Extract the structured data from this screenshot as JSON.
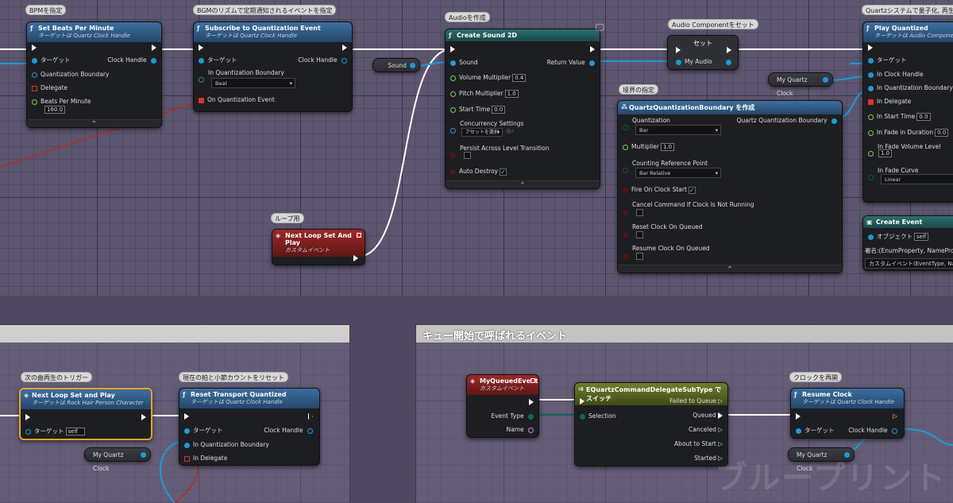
{
  "colors": {
    "exec": "#ffffff",
    "object": "#1c9ad6",
    "float": "#6bd14e",
    "delegate": "#e23030",
    "struct": "#2b8a8a",
    "byte": "#0a5a4a",
    "bool": "#8a1a1a",
    "name": "#c87df0"
  },
  "comments": {
    "bpm": "BPMを指定",
    "subscribe": "BGMのリズムで定期通知されるイベントを指定",
    "audio": "Audioを作成",
    "audio_comp": "Audio Componentをセット",
    "quantized": "Quartzシステムで量子化, 再生開",
    "boundary": "境界の指定",
    "loop": "ループ用",
    "next_trigger": "次の曲再生のトリガー",
    "reset": "現在の拍と小節カウントをリセット",
    "resume": "クロックを再開"
  },
  "regions": {
    "queue_title": "キュー開始で呼ばれるイベント"
  },
  "nodes": {
    "set_bpm": {
      "title": "Set Beats Per Minute",
      "sub": "ターゲットは Quartz Clock Handle",
      "target": "ターゲット",
      "clock_handle": "Clock Handle",
      "quant_boundary": "Quantization Boundary",
      "delegate": "Delegate",
      "bpm_label": "Beats Per Minute",
      "bpm_value": "160.0"
    },
    "subscribe": {
      "title": "Subscribe to Quantization Event",
      "sub": "ターゲットは Quartz Clock Handle",
      "target": "ターゲット",
      "clock_handle": "Clock Handle",
      "in_boundary": "In Quantization Boundary",
      "boundary_value": "Beat",
      "on_event": "On Quantization Event"
    },
    "create_sound": {
      "title": "Create Sound 2D",
      "sound": "Sound",
      "return_value": "Return Value",
      "volume": "Volume Multiplier",
      "volume_value": "0.4",
      "pitch": "Pitch Multiplier",
      "pitch_value": "1.0",
      "start": "Start Time",
      "start_value": "0.0",
      "concurrency": "Concurrency Settings",
      "concurrency_value": "アセットを選択",
      "persist": "Persist Across Level Transition",
      "auto_destroy": "Auto Destroy"
    },
    "sound_var": "Sound",
    "set_node": {
      "title": "セット",
      "my_audio": "My Audio"
    },
    "play_quantized": {
      "title": "Play Quantized",
      "sub": "ターゲットは Audio Component",
      "target": "ターゲット",
      "in_clock": "In Clock Handle",
      "in_boundary": "In Quantization Boundary",
      "in_delegate": "In Delegate",
      "in_start": "In Start Time",
      "in_start_value": "0.0",
      "fade_dur": "In Fade in Duration",
      "fade_dur_value": "0.0",
      "fade_vol": "In Fade Volume Level",
      "fade_vol_value": "1.0",
      "fade_curve": "In Fade Curve",
      "fade_curve_value": "Linear"
    },
    "my_clock_top": "My Quartz Clock",
    "make_boundary": {
      "title": "QuartzQuantizationBoundary を作成",
      "quantization": "Quantization",
      "quantization_value": "Bar",
      "out": "Quartz Quantization Boundary",
      "multiplier": "Multiplier",
      "multiplier_value": "1.0",
      "counting": "Counting Reference Point",
      "counting_value": "Bar Relative",
      "fire": "Fire On Clock Start",
      "cancel": "Cancel Command If Clock Is Not Running",
      "reset": "Reset Clock On Queued",
      "resume": "Resume Clock On Queued"
    },
    "create_event": {
      "title": "Create Event",
      "object": "オブジェクト",
      "object_value": "self",
      "event_label": "イ",
      "sig": "署名:(EnumProperty, NamePrope",
      "custom": "カスタムイベント(EventType, Na"
    },
    "next_loop_event": {
      "title": "Next Loop Set And Play",
      "sub": "カスタムイベント"
    },
    "next_loop_call": {
      "title": "Next Loop Set and Play",
      "sub": "ターゲットは Rock Hair Person Character",
      "target": "ターゲット",
      "target_value": "self"
    },
    "reset_transport": {
      "title": "Reset Transport Quantized",
      "sub": "ターゲットは Quartz Clock Handle",
      "target": "ターゲット",
      "clock_handle": "Clock Handle",
      "in_boundary": "In Quantization Boundary",
      "in_delegate": "In Delegate"
    },
    "my_clock_bottom1": "My Quartz Clock",
    "queued_event": {
      "title": "MyQueuedEvent",
      "sub": "カスタムイベント",
      "event_type": "Event Type",
      "name": "Name"
    },
    "switch": {
      "title": "EQuartzCommandDelegateSubType でスイッチ",
      "selection": "Selection",
      "failed": "Failed to Queue",
      "queued": "Queued",
      "canceled": "Canceled",
      "about": "About to Start",
      "started": "Started"
    },
    "resume_clock": {
      "title": "Resume Clock",
      "sub": "ターゲットは Quartz Clock Handle",
      "target": "ターゲット",
      "clock_handle": "Clock Handle"
    },
    "my_clock_bottom2": "My Quartz Clock"
  },
  "watermark": "ブループリント"
}
